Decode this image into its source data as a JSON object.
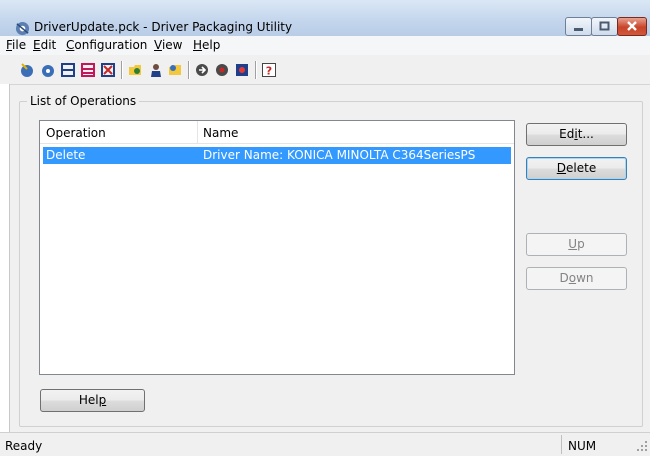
{
  "window": {
    "title": "DriverUpdate.pck - Driver Packaging Utility"
  },
  "menu": {
    "items": [
      {
        "label": "File",
        "accel": "F",
        "rest": "ile"
      },
      {
        "label": "Edit",
        "accel": "E",
        "rest": "dit"
      },
      {
        "label": "Configuration",
        "accel": "C",
        "rest": "onfiguration"
      },
      {
        "label": "View",
        "accel": "V",
        "rest": "iew"
      },
      {
        "label": "Help",
        "accel": "H",
        "rest": "elp"
      }
    ]
  },
  "toolbar": {
    "icons": [
      "new-package-icon",
      "open-package-icon",
      "save-icon",
      "save-as-icon",
      "delete-package-icon",
      "add-driver-icon",
      "user-icon",
      "folder-icon",
      "import-icon",
      "export-icon",
      "settings-icon",
      "about-help-icon"
    ]
  },
  "group": {
    "label": "List of Operations"
  },
  "list": {
    "columns": [
      "Operation",
      "Name"
    ],
    "rows": [
      {
        "operation": "Delete",
        "name": "Driver Name: KONICA MINOLTA C364SeriesPS",
        "selected": true
      }
    ]
  },
  "buttons": {
    "edit": {
      "pre": "Ed",
      "accel": "i",
      "post": "t..."
    },
    "delete": {
      "pre": "",
      "accel": "D",
      "post": "elete"
    },
    "up": {
      "pre": "",
      "accel": "U",
      "post": "p"
    },
    "down": {
      "pre": "D",
      "accel": "o",
      "post": "wn"
    },
    "help": {
      "pre": "Hel",
      "accel": "p",
      "post": ""
    }
  },
  "status": {
    "text": "Ready",
    "num": "NUM"
  },
  "colors": {
    "selection": "#3399ff",
    "close_button": "#c8442a",
    "titlebar": "#c3d5ec"
  }
}
